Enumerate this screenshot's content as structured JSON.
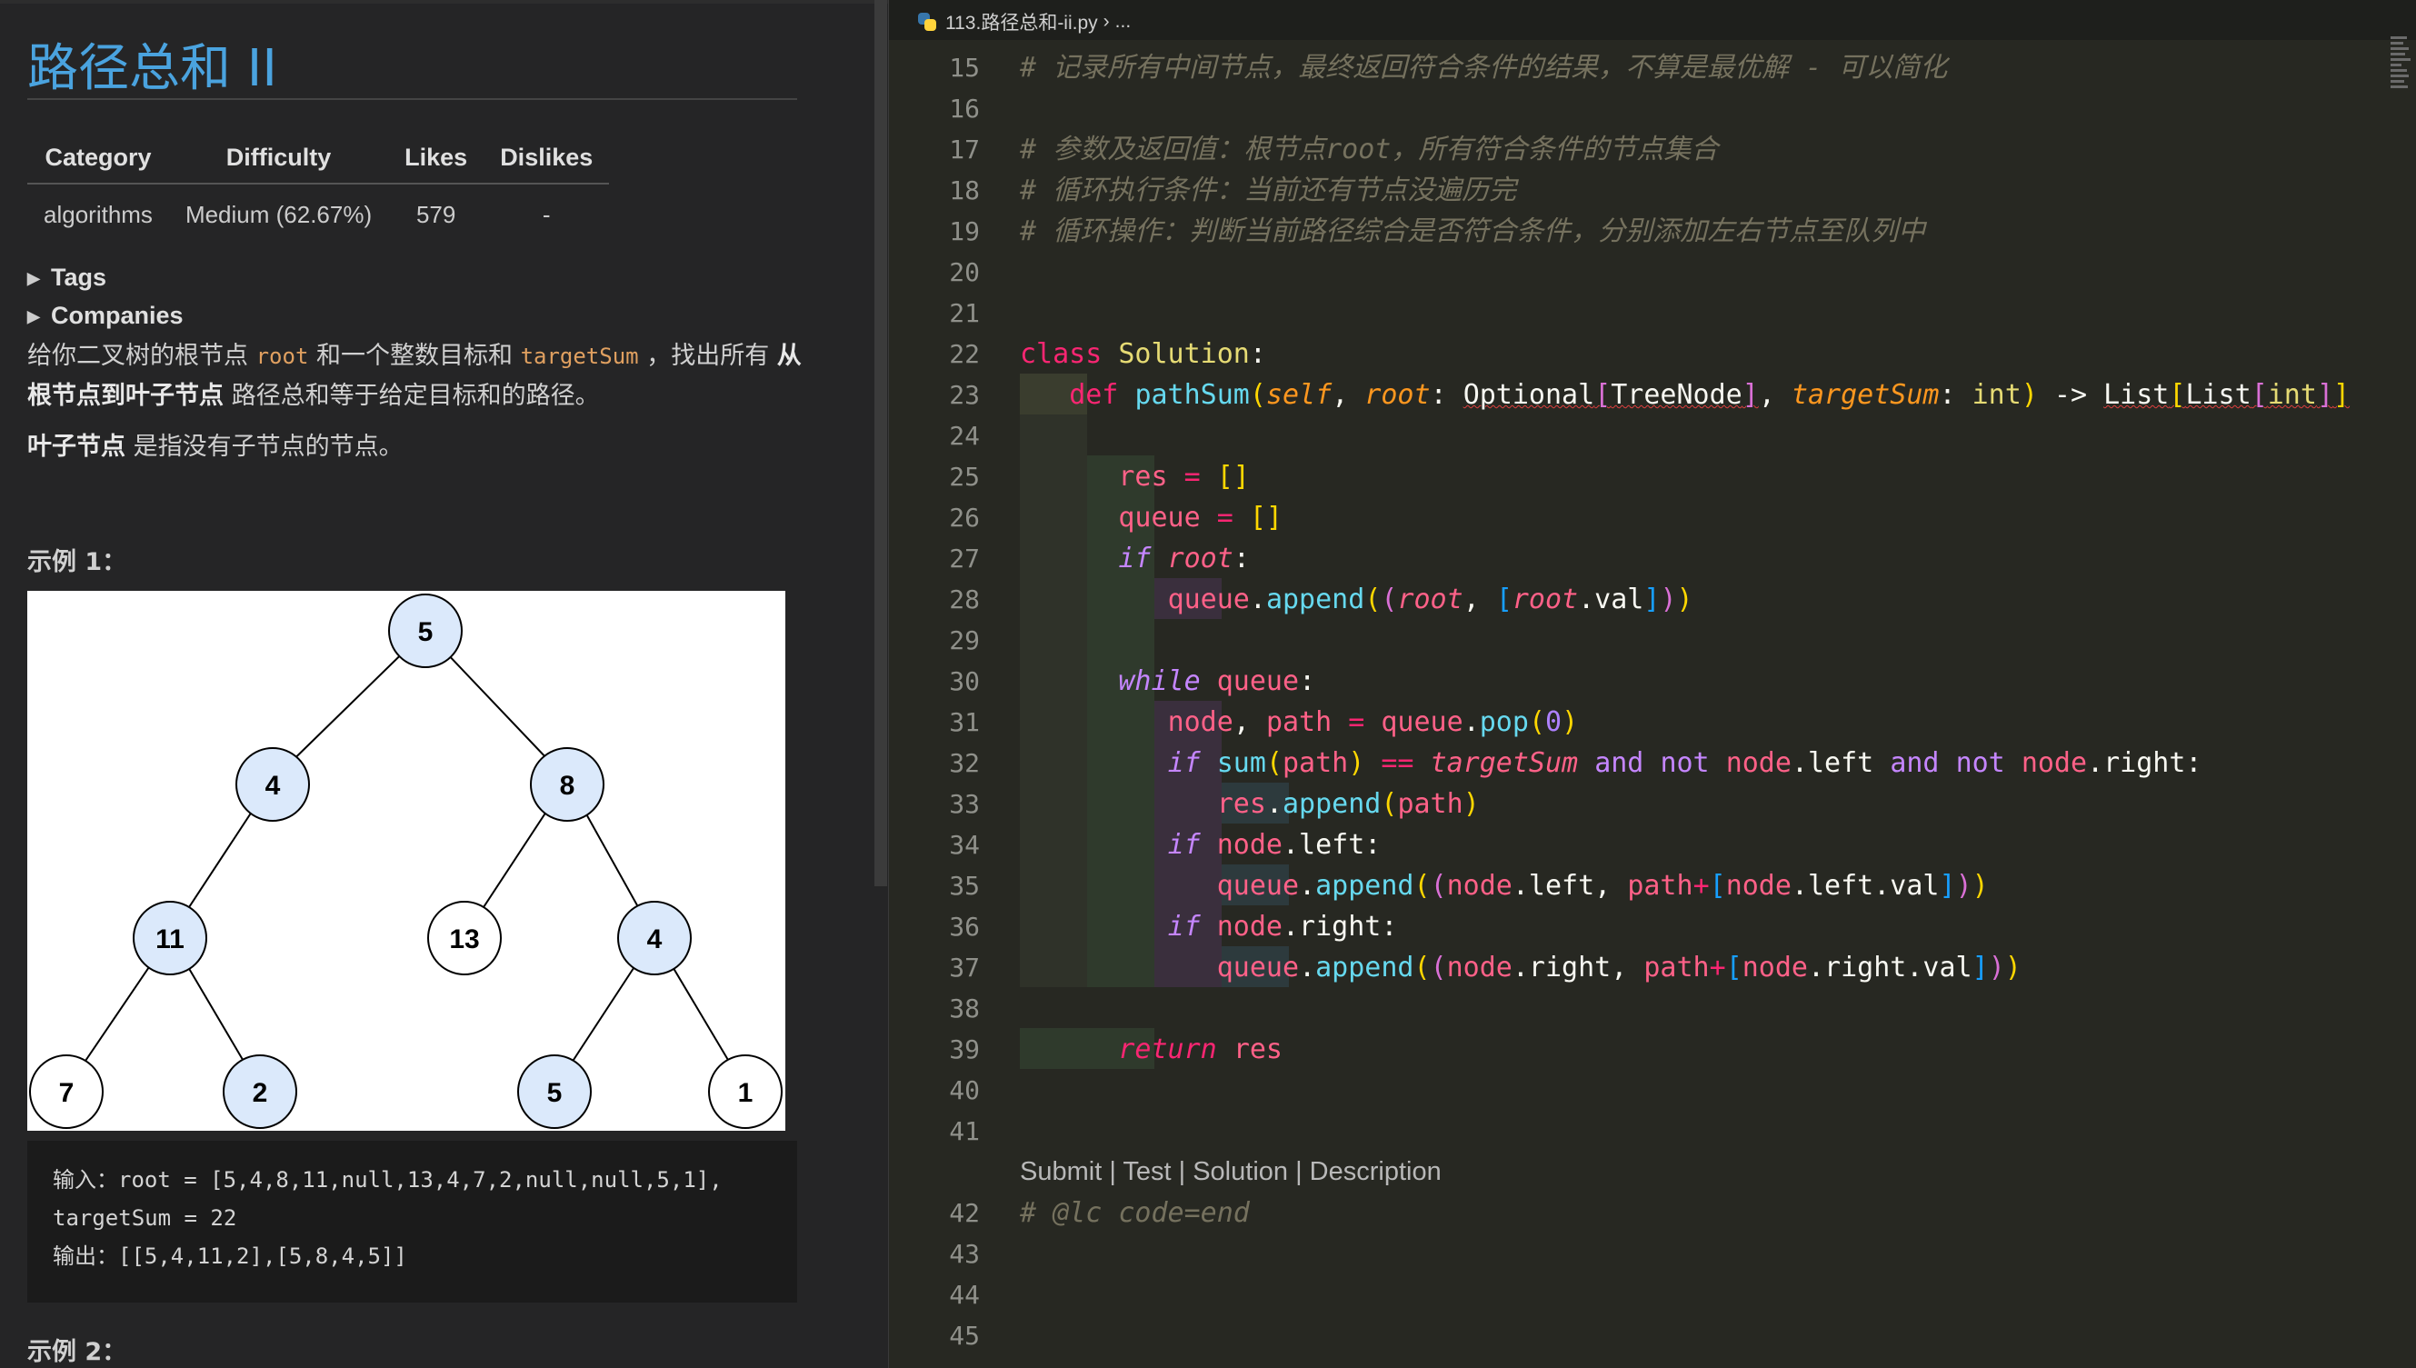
{
  "problem": {
    "title": "路径总和 II",
    "table": {
      "headers": [
        "Category",
        "Difficulty",
        "Likes",
        "Dislikes"
      ],
      "row": [
        "algorithms",
        "Medium (62.67%)",
        "579",
        "-"
      ]
    },
    "tags_label": "Tags",
    "companies_label": "Companies",
    "desc_p1_a": "给你二叉树的根节点 ",
    "desc_p1_root": "root",
    "desc_p1_b": " 和一个整数目标和 ",
    "desc_p1_target": "targetSum",
    "desc_p1_c": " ，找出所有 ",
    "desc_p1_bold": "从根节点到叶子节点",
    "desc_p1_d": " 路径总和等于给定目标和的路径。",
    "desc_p2_bold": "叶子节点",
    "desc_p2_rest": " 是指没有子节点的节点。",
    "example1_label": "示例 1：",
    "example2_label": "示例 2：",
    "example1_io": {
      "line1": "输入：root = [5,4,8,11,null,13,4,7,2,null,null,5,1],",
      "line2": "targetSum = 22",
      "line3": "输出：[[5,4,11,2],[5,8,4,5]]"
    },
    "tree_nodes": [
      "5",
      "4",
      "8",
      "11",
      "13",
      "4",
      "7",
      "2",
      "5",
      "1"
    ],
    "highlight_color": "#dbe9fb"
  },
  "editor": {
    "tab_label": "113.路径总和-ii.py",
    "breadcrumb_sep": "›",
    "breadcrumb_more": "...",
    "codelens": "Submit | Test | Solution | Description",
    "line_numbers": [
      "15",
      "16",
      "17",
      "18",
      "19",
      "20",
      "21",
      "22",
      "23",
      "24",
      "25",
      "26",
      "27",
      "28",
      "29",
      "30",
      "31",
      "32",
      "33",
      "34",
      "35",
      "36",
      "37",
      "38",
      "39",
      "40",
      "41",
      "42",
      "43",
      "44",
      "45"
    ]
  },
  "colors": {
    "accent_title": "#4aa3df",
    "editor_bg": "#272822",
    "panel_bg": "#252526"
  }
}
